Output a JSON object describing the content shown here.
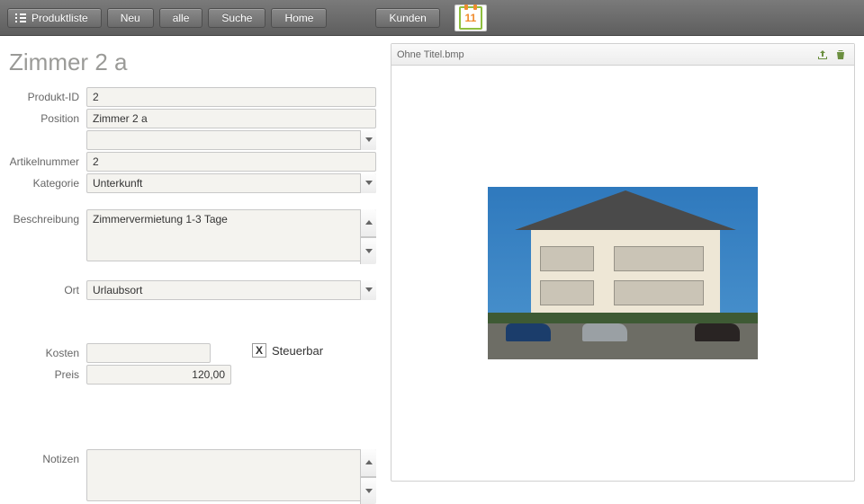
{
  "toolbar": {
    "produktliste": "Produktliste",
    "neu": "Neu",
    "alle": "alle",
    "suche": "Suche",
    "home": "Home",
    "kunden": "Kunden",
    "logo_day": "11"
  },
  "page_title": "Zimmer 2 a",
  "labels": {
    "produkt_id": "Produkt-ID",
    "position": "Position",
    "artikelnummer": "Artikelnummer",
    "kategorie": "Kategorie",
    "beschreibung": "Beschreibung",
    "ort": "Ort",
    "kosten": "Kosten",
    "preis": "Preis",
    "steuerbar": "Steuerbar",
    "notizen": "Notizen"
  },
  "fields": {
    "produkt_id": "2",
    "position": "Zimmer 2 a",
    "position_extra": "",
    "artikelnummer": "2",
    "kategorie": "Unterkunft",
    "beschreibung": "Zimmervermietung 1-3 Tage",
    "ort": "Urlaubsort",
    "kosten": "",
    "preis": "120,00",
    "steuerbar_checked": "X",
    "notizen": ""
  },
  "image_card": {
    "title": "Ohne Titel.bmp",
    "export_icon": "export-icon",
    "delete_icon": "trash-icon"
  }
}
